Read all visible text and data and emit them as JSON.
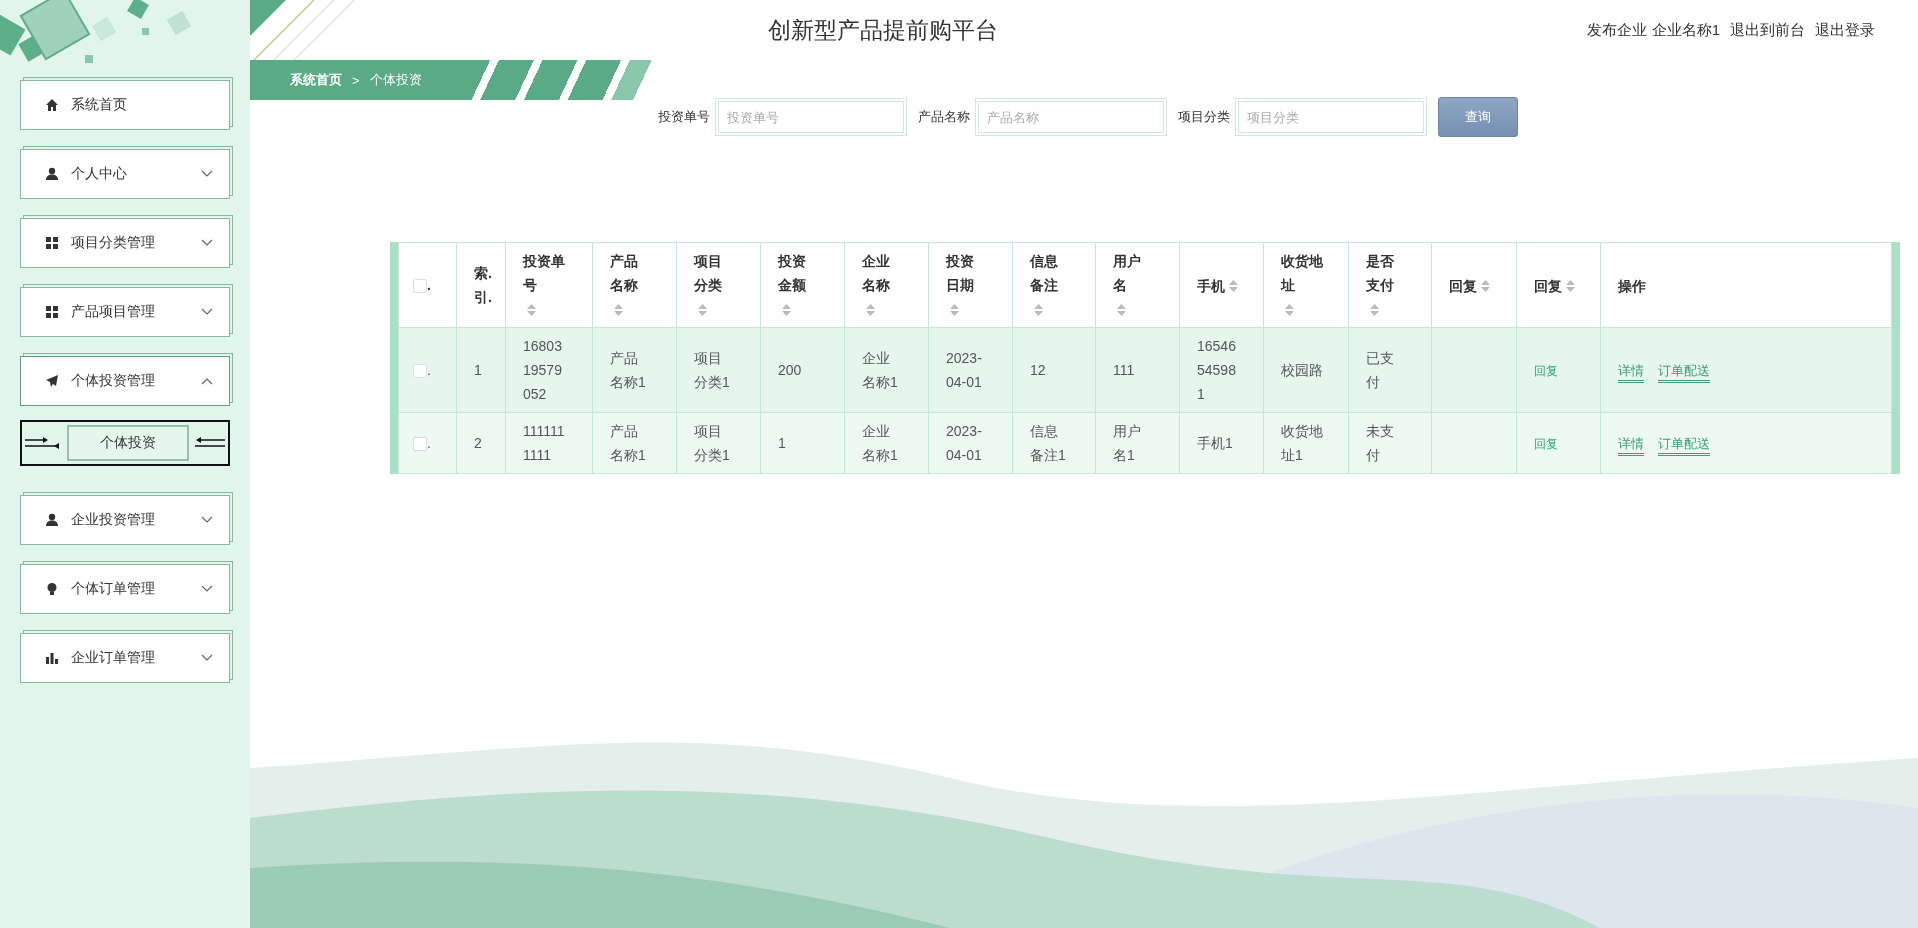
{
  "header": {
    "title": "创新型产品提前购平台",
    "user_links": [
      "发布企业 企业名称1",
      "退出到前台",
      "退出登录"
    ]
  },
  "breadcrumb": {
    "items": [
      "系统首页",
      "个体投资"
    ],
    "separator": ">"
  },
  "sidebar": {
    "items": [
      {
        "label": "系统首页"
      },
      {
        "label": "个人中心",
        "expanded": false
      },
      {
        "label": "项目分类管理",
        "expanded": false
      },
      {
        "label": "产品项目管理",
        "expanded": false
      },
      {
        "label": "个体投资管理",
        "expanded": true,
        "children": [
          {
            "label": "个体投资",
            "selected": true
          }
        ]
      },
      {
        "label": "企业投资管理",
        "expanded": false
      },
      {
        "label": "个体订单管理",
        "expanded": false
      },
      {
        "label": "企业订单管理",
        "expanded": false
      }
    ]
  },
  "search": {
    "fields": [
      {
        "label": "投资单号",
        "placeholder": "投资单号"
      },
      {
        "label": "产品名称",
        "placeholder": "产品名称"
      },
      {
        "label": "项目分类",
        "placeholder": "项目分类"
      }
    ],
    "button": "查询"
  },
  "table": {
    "select_label": ".",
    "select_checked": false,
    "columns": [
      {
        "label": "索.引.",
        "sortable": false
      },
      {
        "label": "投资单号",
        "sortable": true
      },
      {
        "label": "产品名称",
        "sortable": true
      },
      {
        "label": "项目分类",
        "sortable": true
      },
      {
        "label": "投资金额",
        "sortable": true
      },
      {
        "label": "企业名称",
        "sortable": true
      },
      {
        "label": "投资日期",
        "sortable": true
      },
      {
        "label": "信息备注",
        "sortable": true
      },
      {
        "label": "用户名",
        "sortable": true
      },
      {
        "label": "手机",
        "sortable": true
      },
      {
        "label": "收货地址",
        "sortable": true
      },
      {
        "label": "是否支付",
        "sortable": true
      },
      {
        "label": "回复",
        "sortable": true
      },
      {
        "label": "回复",
        "sortable": true
      },
      {
        "label": "操作",
        "sortable": false
      }
    ],
    "rows": [
      {
        "checked": false,
        "select_label": ".",
        "cells": [
          {
            "kind": "text",
            "text": "1"
          },
          {
            "kind": "text",
            "text": "1680319579052"
          },
          {
            "kind": "text",
            "text": "产品名称1"
          },
          {
            "kind": "text",
            "text": "项目分类1"
          },
          {
            "kind": "text",
            "text": "200"
          },
          {
            "kind": "text",
            "text": "企业名称1"
          },
          {
            "kind": "text",
            "text": "2023-04-01"
          },
          {
            "kind": "text",
            "text": "12"
          },
          {
            "kind": "text",
            "text": "111"
          },
          {
            "kind": "text",
            "text": "16546545981"
          },
          {
            "kind": "text",
            "text": "校园路"
          },
          {
            "kind": "text",
            "text": "已支付"
          },
          {
            "kind": "empty"
          },
          {
            "kind": "link",
            "text": "回复"
          },
          {
            "kind": "actions",
            "actions": [
              "详情",
              "订单配送"
            ]
          }
        ]
      },
      {
        "checked": false,
        "select_label": ".",
        "cells": [
          {
            "kind": "text",
            "text": "2"
          },
          {
            "kind": "text",
            "text": "1111111111"
          },
          {
            "kind": "text",
            "text": "产品名称1"
          },
          {
            "kind": "text",
            "text": "项目分类1"
          },
          {
            "kind": "text",
            "text": "1"
          },
          {
            "kind": "text",
            "text": "企业名称1"
          },
          {
            "kind": "text",
            "text": "2023-04-01"
          },
          {
            "kind": "text",
            "text": "信息备注1"
          },
          {
            "kind": "text",
            "text": "用户名1"
          },
          {
            "kind": "text",
            "text": "手机1"
          },
          {
            "kind": "text",
            "text": "收货地址1"
          },
          {
            "kind": "text",
            "text": "未支付"
          },
          {
            "kind": "empty"
          },
          {
            "kind": "link",
            "text": "回复"
          },
          {
            "kind": "actions",
            "actions": [
              "详情",
              "订单配送"
            ]
          }
        ]
      }
    ]
  }
}
